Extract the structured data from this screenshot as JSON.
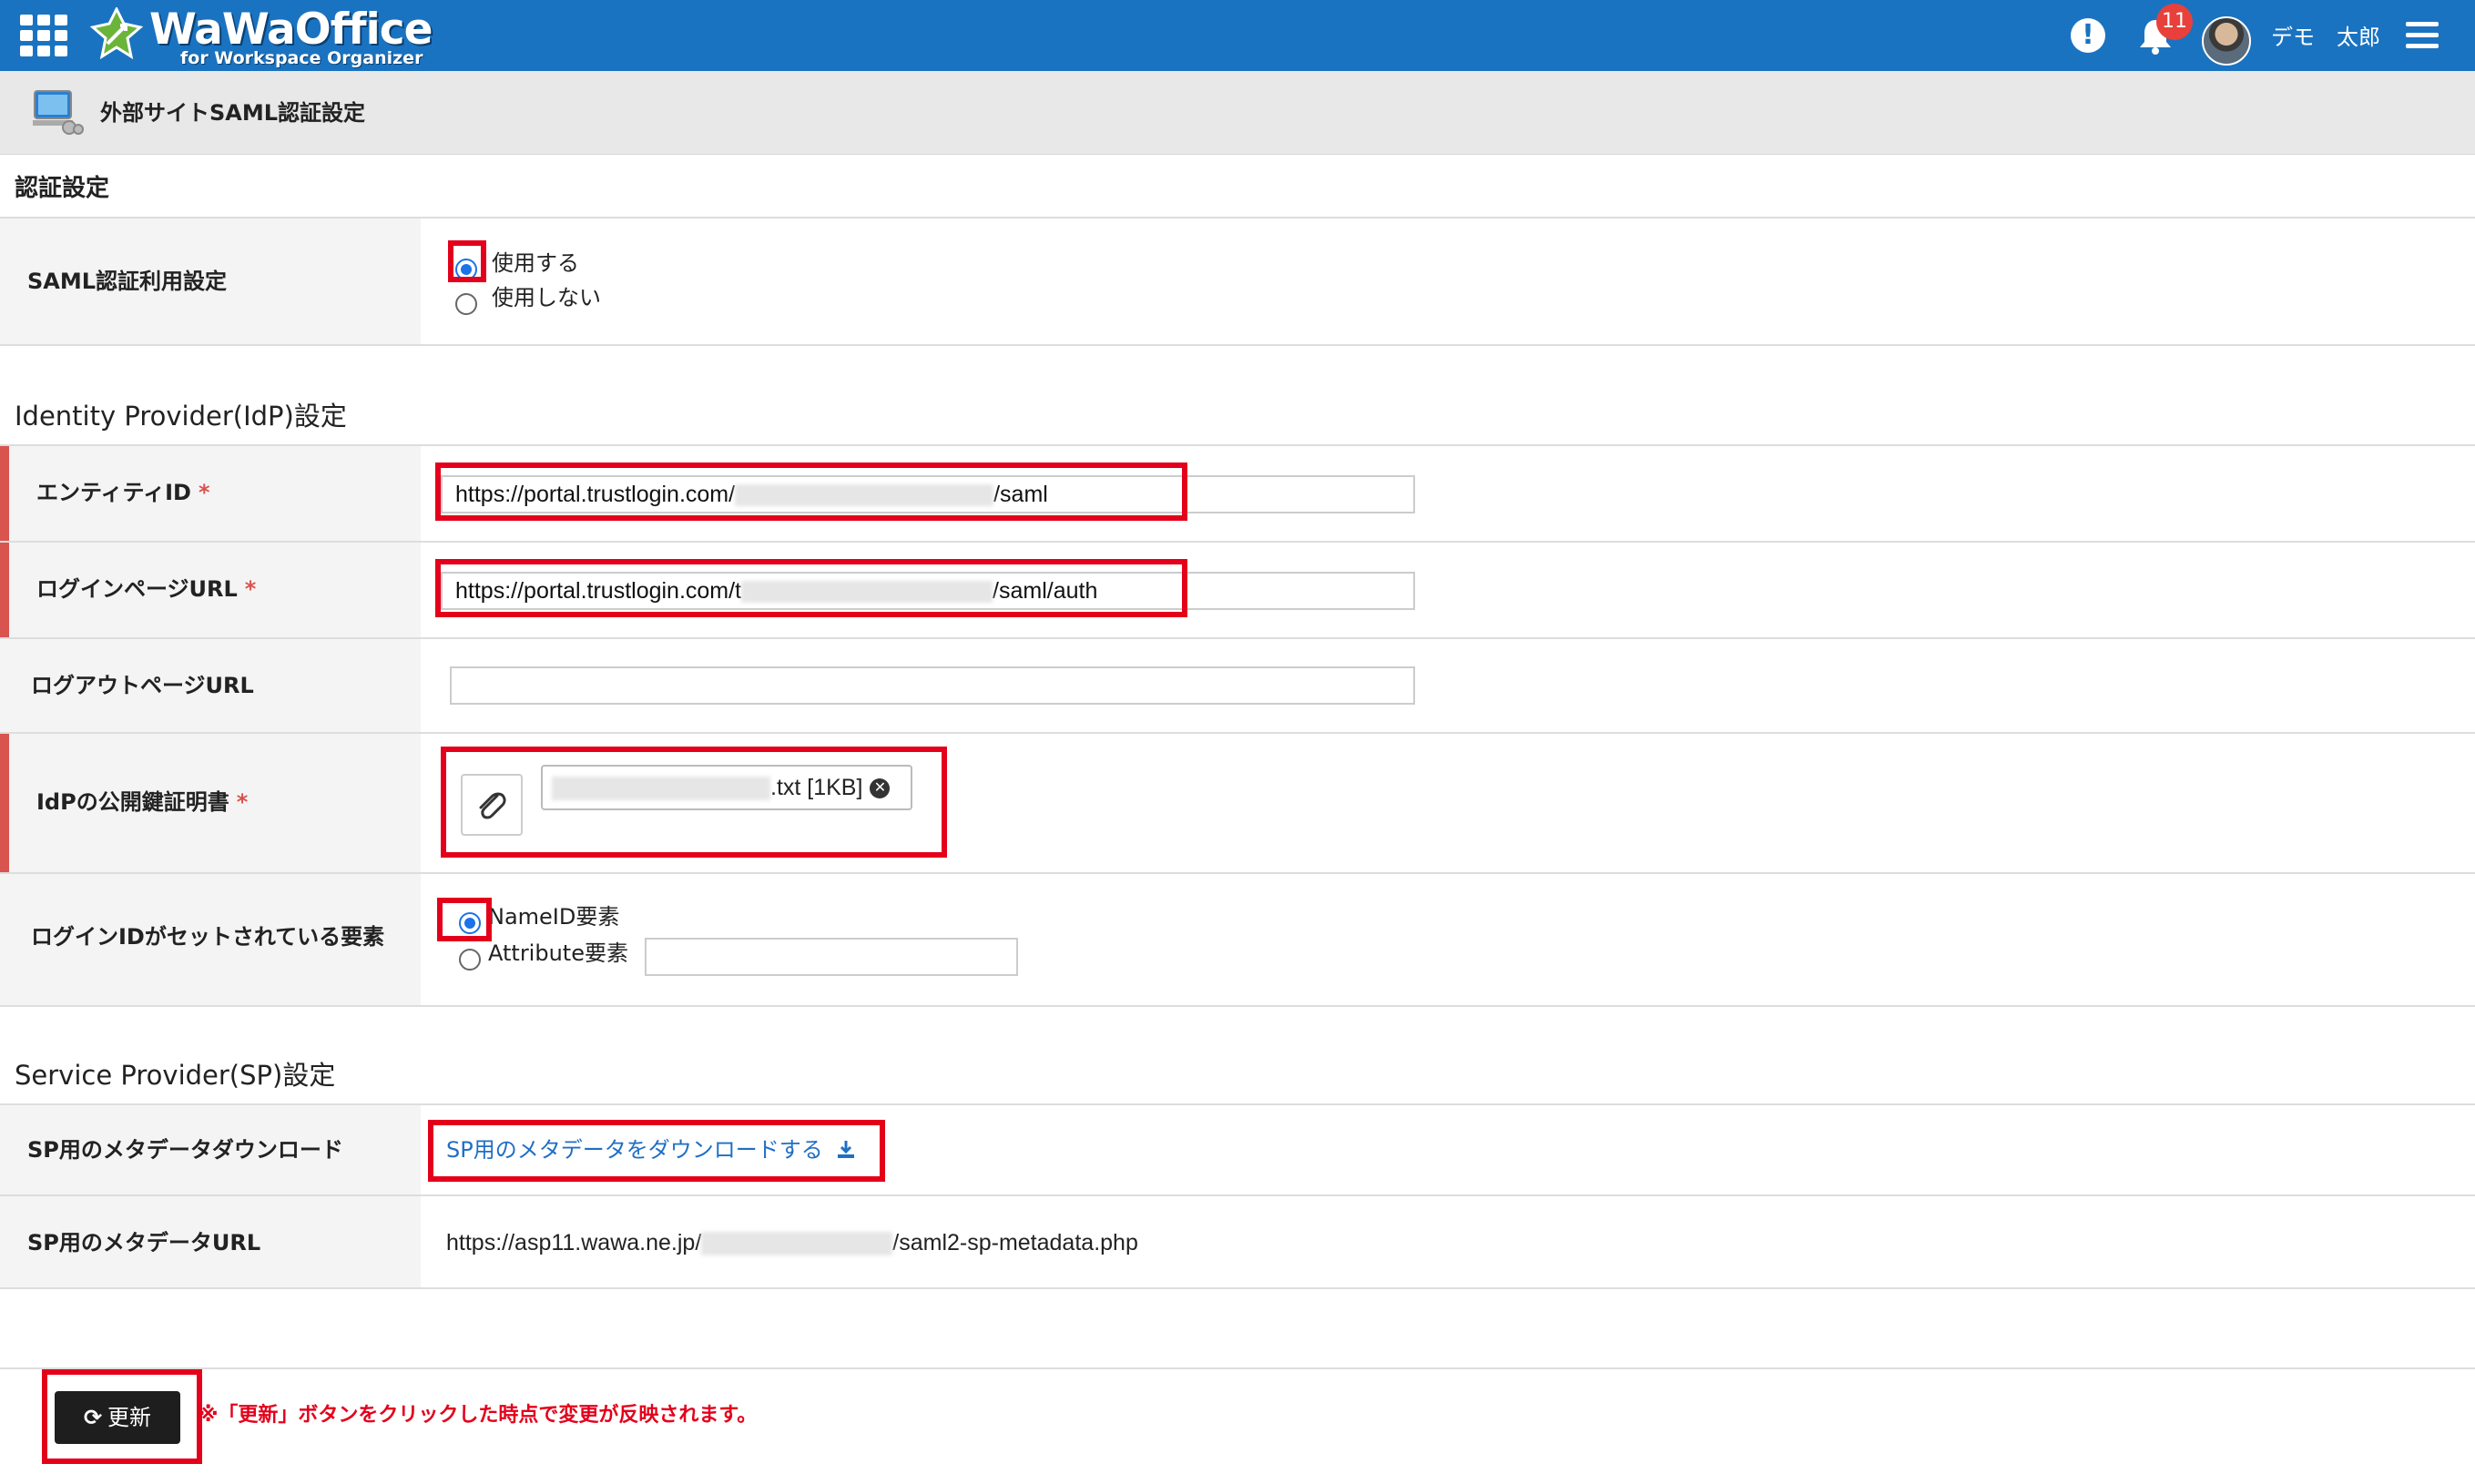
{
  "header": {
    "logo_title": "WaWaOffice",
    "logo_subtitle": "for Workspace Organizer",
    "notification_count": "11",
    "user_name": "デモ　太郎"
  },
  "page": {
    "title": "外部サイトSAML認証設定"
  },
  "auth_section": {
    "title": "認証設定",
    "saml_label": "SAML認証利用設定",
    "option_use": "使用する",
    "option_not_use": "使用しない",
    "selected": "使用する"
  },
  "idp_section": {
    "title": "Identity Provider(IdP)設定",
    "entity_id_label": "エンティティID",
    "entity_id_prefix": "https://portal.trustlogin.com/",
    "entity_id_suffix": "/saml",
    "login_url_label": "ログインページURL",
    "login_url_prefix": "https://portal.trustlogin.com/t",
    "login_url_suffix": "/saml/auth",
    "logout_url_label": "ログアウトページURL",
    "logout_url_value": "",
    "cert_label": "IdPの公開鍵証明書",
    "cert_file_suffix": ".txt [1KB]",
    "login_id_label": "ログインIDがセットされている要素",
    "option_nameid": "NameID要素",
    "option_attribute": "Attribute要素",
    "attribute_value": "",
    "required_mark": "*"
  },
  "sp_section": {
    "title": "Service Provider(SP)設定",
    "download_label": "SP用のメタデータダウンロード",
    "download_link": "SP用のメタデータをダウンロードする",
    "metadata_url_label": "SP用のメタデータURL",
    "metadata_url_prefix": "https://asp11.wawa.ne.jp/",
    "metadata_url_suffix": "/saml2-sp-metadata.php"
  },
  "footer": {
    "update_button": "更新",
    "notice": "※「更新」ボタンをクリックした時点で変更が反映されます。"
  },
  "colors": {
    "topbar": "#1a73c1",
    "highlight": "#e4001b",
    "required": "#d9534f",
    "link": "#1f6fc5"
  }
}
